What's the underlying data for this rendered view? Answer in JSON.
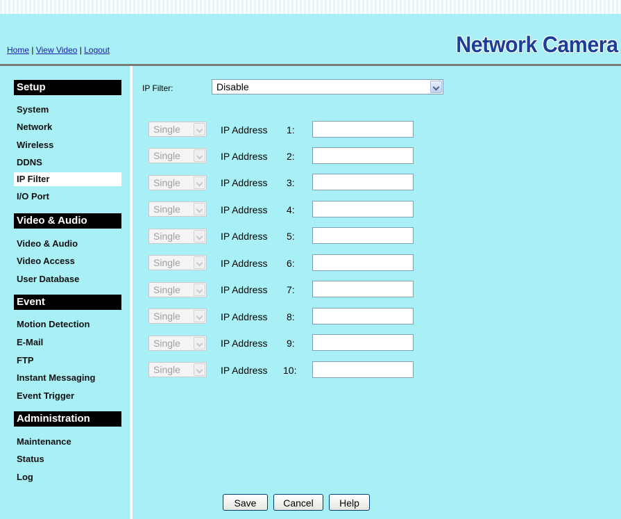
{
  "header": {
    "links": [
      "Home",
      "View Video",
      "Logout"
    ],
    "brand": "Network Camera"
  },
  "sidebar": {
    "sections": [
      {
        "title": "Setup",
        "items": [
          "System",
          "Network",
          "Wireless",
          "DDNS",
          "IP Filter",
          "I/O Port"
        ]
      },
      {
        "title": "Video & Audio",
        "items": [
          "Video & Audio",
          "Video Access",
          "User Database"
        ]
      },
      {
        "title": "Event",
        "items": [
          "Motion Detection",
          "E-Mail",
          "FTP",
          "Instant Messaging",
          "Event Trigger"
        ]
      },
      {
        "title": "Administration",
        "items": [
          "Maintenance",
          "Status",
          "Log"
        ]
      }
    ],
    "active": "IP Filter"
  },
  "main": {
    "filter_label": "IP Filter:",
    "filter_value": "Disable",
    "rows": [
      {
        "type": "Single",
        "label": "IP Address",
        "num": "1:",
        "value": ""
      },
      {
        "type": "Single",
        "label": "IP Address",
        "num": "2:",
        "value": ""
      },
      {
        "type": "Single",
        "label": "IP Address",
        "num": "3:",
        "value": ""
      },
      {
        "type": "Single",
        "label": "IP Address",
        "num": "4:",
        "value": ""
      },
      {
        "type": "Single",
        "label": "IP Address",
        "num": "5:",
        "value": ""
      },
      {
        "type": "Single",
        "label": "IP Address",
        "num": "6:",
        "value": ""
      },
      {
        "type": "Single",
        "label": "IP Address",
        "num": "7:",
        "value": ""
      },
      {
        "type": "Single",
        "label": "IP Address",
        "num": "8:",
        "value": ""
      },
      {
        "type": "Single",
        "label": "IP Address",
        "num": "9:",
        "value": ""
      },
      {
        "type": "Single",
        "label": "IP Address",
        "num": "10:",
        "value": ""
      }
    ],
    "buttons": {
      "save": "Save",
      "cancel": "Cancel",
      "help": "Help"
    }
  }
}
